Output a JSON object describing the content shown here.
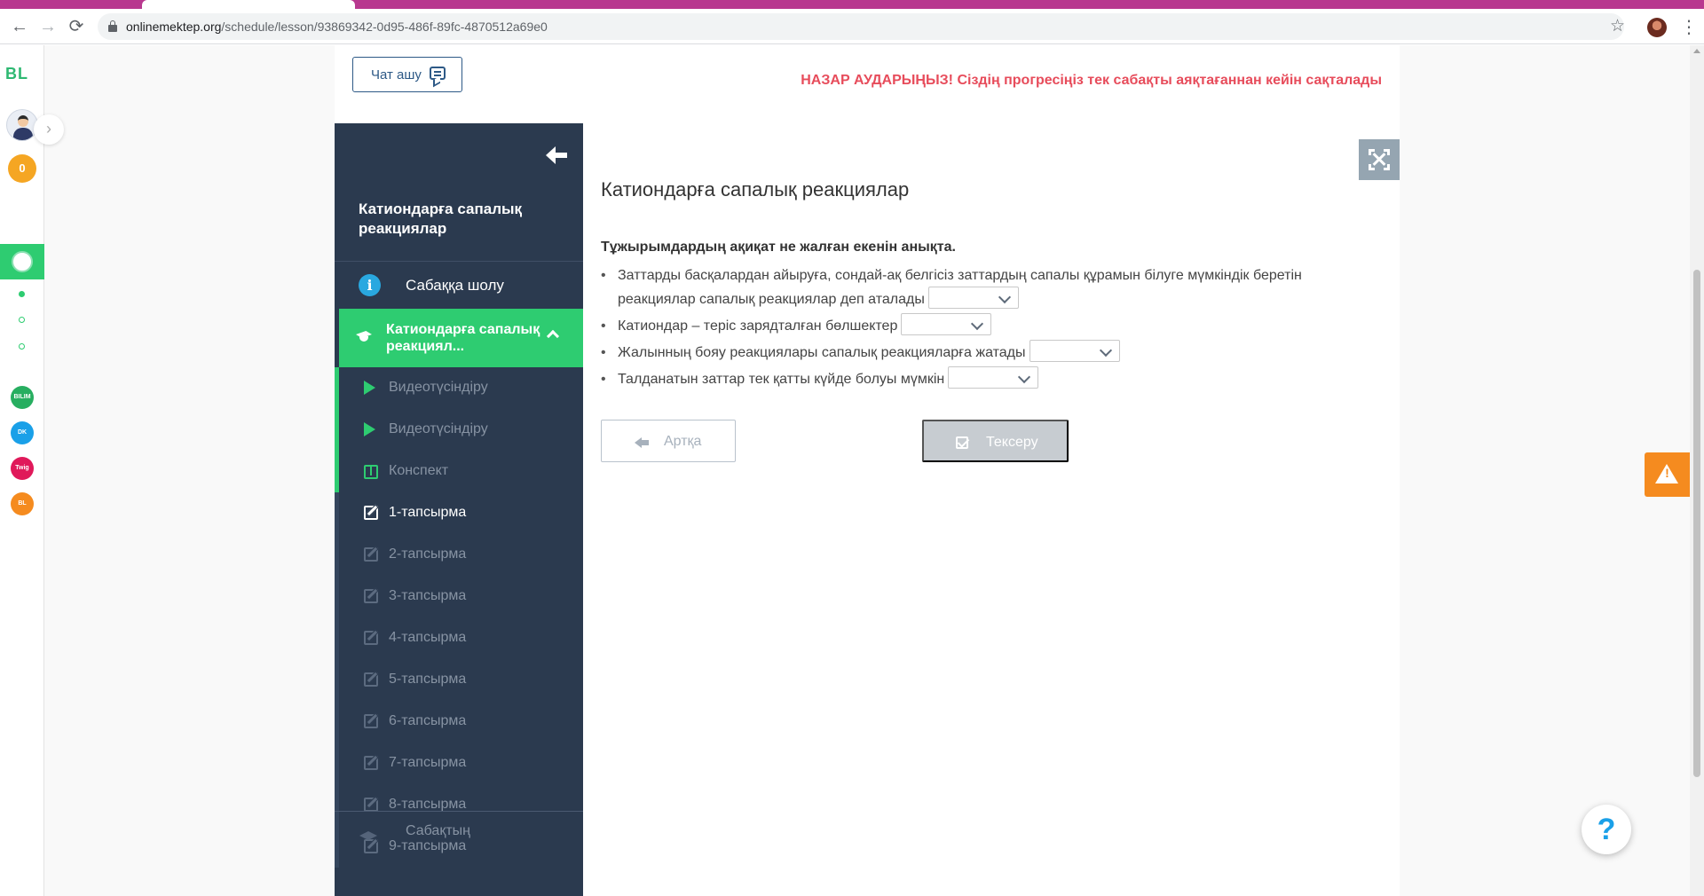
{
  "browser": {
    "url_domain": "onlinemektep.org",
    "url_path": "/schedule/lesson/93869342-0d95-486f-89fc-4870512a69e0",
    "tab_color": "#b8388f"
  },
  "rail": {
    "logo": "BL",
    "coins": "0",
    "apps": [
      {
        "icon": "online-mektep-icon",
        "color": "#2ecc71"
      },
      {
        "icon": "bilimland-icon",
        "color": "#27ae60",
        "text": "BILIM"
      },
      {
        "icon": "daryn-icon",
        "color": "#1aa0e8",
        "text": "DK"
      },
      {
        "icon": "twig-icon",
        "color": "#e0195a",
        "text": "Twig"
      },
      {
        "icon": "bilimland-orange-icon",
        "color": "#f58b1f",
        "text": "BL"
      }
    ]
  },
  "header": {
    "chat_button": "Чат ашу",
    "notice": "НАЗАР АУДАРЫҢЫЗ! Сіздің прогресіңіз тек сабақты аяқтағаннан кейін сақталады"
  },
  "sidebar": {
    "title": "Катиондарға сапалық реакциялар",
    "overview": "Сабаққа шолу",
    "section": "Катиондарға сапалық реакциял...",
    "items": [
      {
        "label": "Видеотүсіндіру",
        "icon": "play-icon",
        "active": false
      },
      {
        "label": "Видеотүсіндіру",
        "icon": "play-icon",
        "active": false
      },
      {
        "label": "Конспект",
        "icon": "book-icon",
        "active": false
      },
      {
        "label": "1-тапсырма",
        "icon": "edit-icon",
        "active": true
      },
      {
        "label": "2-тапсырма",
        "icon": "edit-icon",
        "active": false
      },
      {
        "label": "3-тапсырма",
        "icon": "edit-icon",
        "active": false
      },
      {
        "label": "4-тапсырма",
        "icon": "edit-icon",
        "active": false
      },
      {
        "label": "5-тапсырма",
        "icon": "edit-icon",
        "active": false
      },
      {
        "label": "6-тапсырма",
        "icon": "edit-icon",
        "active": false
      },
      {
        "label": "7-тапсырма",
        "icon": "edit-icon",
        "active": false
      },
      {
        "label": "8-тапсырма",
        "icon": "edit-icon",
        "active": false
      },
      {
        "label": "9-тапсырма",
        "icon": "edit-icon",
        "active": false
      }
    ],
    "bottom": "Сабақтың"
  },
  "task": {
    "title": "Катиондарға сапалық реакциялар",
    "instruction": "Тұжырымдардың ақиқат не жалған екенін анықта.",
    "statements": [
      {
        "text": "Заттарды басқалардан айыруға, сондай-ақ белгісіз заттардың сапалы құрамын білуге мүмкіндік беретін реакциялар сапалық реакциялар деп аталады",
        "selected": ""
      },
      {
        "text": "Катиондар – теріс зарядталған бөлшектер",
        "selected": ""
      },
      {
        "text": "Жалынның бояу реакциялары сапалық реакцияларға жатады",
        "selected": ""
      },
      {
        "text": "Талданатын заттар тек қатты күйде болуы мүмкін",
        "selected": ""
      }
    ],
    "back_button": "Артқа",
    "check_button": "Тексеру"
  },
  "colors": {
    "accent_green": "#2ecc71",
    "sidebar_bg": "#2b3a4f",
    "notice_red": "#e74c5b",
    "warning_orange": "#f58b1f"
  }
}
